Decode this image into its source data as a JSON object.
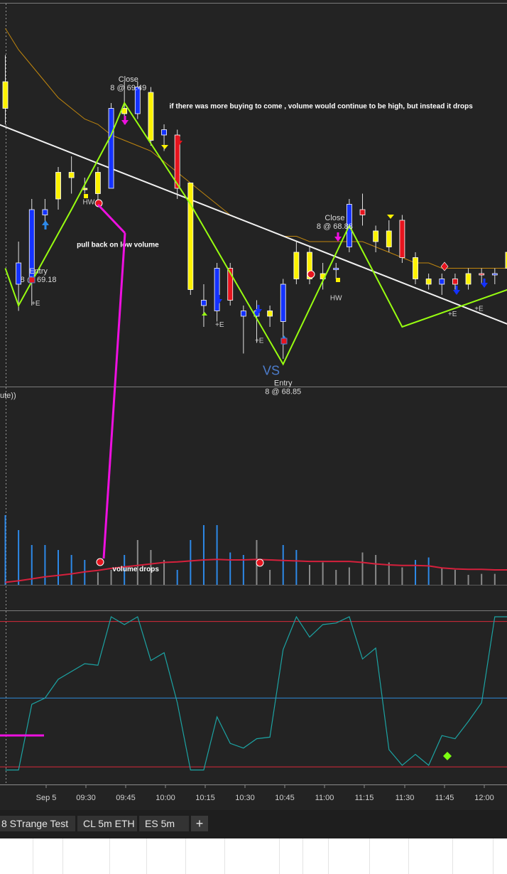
{
  "chart_data": [
    {
      "type": "candlestick",
      "x_labels": [
        "Sep 5",
        "09:30",
        "09:45",
        "10:00",
        "10:15",
        "10:30",
        "10:45",
        "11:00",
        "11:15",
        "11:30",
        "11:45",
        "12:00"
      ],
      "candles": [
        {
          "o": 69.42,
          "h": 69.47,
          "l": 69.34,
          "c": 69.37,
          "color": "yellow"
        },
        {
          "o": 69.04,
          "h": 69.12,
          "l": 68.99,
          "c": 69.08,
          "color": "blue"
        },
        {
          "o": 69.05,
          "h": 69.2,
          "l": 69.0,
          "c": 69.18,
          "color": "blue"
        },
        {
          "o": 69.17,
          "h": 69.2,
          "l": 69.15,
          "c": 69.18,
          "color": "blue"
        },
        {
          "o": 69.2,
          "h": 69.26,
          "l": 69.18,
          "c": 69.25,
          "color": "yellow"
        },
        {
          "o": 69.25,
          "h": 69.28,
          "l": 69.21,
          "c": 69.24,
          "color": "yellow"
        },
        {
          "o": 69.22,
          "h": 69.24,
          "l": 69.21,
          "c": 69.22,
          "color": "yellow"
        },
        {
          "o": 69.21,
          "h": 69.26,
          "l": 69.19,
          "c": 69.25,
          "color": "yellow"
        },
        {
          "o": 69.22,
          "h": 69.38,
          "l": 69.22,
          "c": 69.37,
          "color": "blue"
        },
        {
          "o": 69.36,
          "h": 69.42,
          "l": 69.34,
          "c": 69.37,
          "color": "yellow"
        },
        {
          "o": 69.36,
          "h": 69.42,
          "l": 69.35,
          "c": 69.41,
          "color": "blue"
        },
        {
          "o": 69.4,
          "h": 69.41,
          "l": 69.3,
          "c": 69.31,
          "color": "yellow"
        },
        {
          "o": 69.32,
          "h": 69.34,
          "l": 69.29,
          "c": 69.33,
          "color": "blue"
        },
        {
          "o": 69.32,
          "h": 69.33,
          "l": 69.2,
          "c": 69.22,
          "color": "red"
        },
        {
          "o": 69.23,
          "h": 69.23,
          "l": 69.02,
          "c": 69.03,
          "color": "yellow"
        },
        {
          "o": 69.01,
          "h": 69.04,
          "l": 68.96,
          "c": 69.0,
          "color": "blue"
        },
        {
          "o": 68.99,
          "h": 69.08,
          "l": 68.97,
          "c": 69.07,
          "color": "blue"
        },
        {
          "o": 69.07,
          "h": 69.08,
          "l": 69.0,
          "c": 69.01,
          "color": "red"
        },
        {
          "o": 68.98,
          "h": 69.0,
          "l": 68.91,
          "c": 68.99,
          "color": "blue"
        },
        {
          "o": 68.99,
          "h": 69.01,
          "l": 68.93,
          "c": 68.98,
          "color": "blue"
        },
        {
          "o": 68.99,
          "h": 69.0,
          "l": 68.96,
          "c": 68.98,
          "color": "yellow"
        },
        {
          "o": 68.97,
          "h": 69.05,
          "l": 68.9,
          "c": 69.04,
          "color": "blue"
        },
        {
          "o": 69.1,
          "h": 69.12,
          "l": 69.04,
          "c": 69.05,
          "color": "yellow"
        },
        {
          "o": 69.1,
          "h": 69.11,
          "l": 69.04,
          "c": 69.05,
          "color": "yellow"
        },
        {
          "o": 69.06,
          "h": 69.08,
          "l": 69.03,
          "c": 69.05,
          "color": "yellow"
        },
        {
          "o": 69.07,
          "h": 69.08,
          "l": 69.05,
          "c": 69.07,
          "color": "blue"
        },
        {
          "o": 69.11,
          "h": 69.2,
          "l": 69.1,
          "c": 69.19,
          "color": "blue"
        },
        {
          "o": 69.18,
          "h": 69.21,
          "l": 69.15,
          "c": 69.17,
          "color": "red"
        },
        {
          "o": 69.14,
          "h": 69.15,
          "l": 69.1,
          "c": 69.12,
          "color": "yellow"
        },
        {
          "o": 69.14,
          "h": 69.16,
          "l": 69.1,
          "c": 69.11,
          "color": "yellow"
        },
        {
          "o": 69.16,
          "h": 69.17,
          "l": 69.08,
          "c": 69.09,
          "color": "red"
        },
        {
          "o": 69.09,
          "h": 69.1,
          "l": 69.04,
          "c": 69.05,
          "color": "yellow"
        },
        {
          "o": 69.05,
          "h": 69.06,
          "l": 69.03,
          "c": 69.04,
          "color": "yellow"
        },
        {
          "o": 69.05,
          "h": 69.06,
          "l": 69.02,
          "c": 69.04,
          "color": "blue"
        },
        {
          "o": 69.05,
          "h": 69.06,
          "l": 69.03,
          "c": 69.04,
          "color": "red"
        },
        {
          "o": 69.06,
          "h": 69.07,
          "l": 69.03,
          "c": 69.04,
          "color": "yellow"
        },
        {
          "o": 69.06,
          "h": 69.07,
          "l": 69.04,
          "c": 69.06,
          "color": "red"
        },
        {
          "o": 69.06,
          "h": 69.07,
          "l": 69.04,
          "c": 69.06,
          "color": "blue"
        },
        {
          "o": 69.07,
          "h": 69.11,
          "l": 69.06,
          "c": 69.1,
          "color": "yellow"
        }
      ],
      "moving_average": [
        69.52,
        69.48,
        69.45,
        69.42,
        69.39,
        69.37,
        69.35,
        69.34,
        69.32,
        69.31,
        69.3,
        69.29,
        69.27,
        69.25,
        69.23,
        69.21,
        69.19,
        69.17,
        69.16,
        69.15,
        69.14,
        69.13,
        69.13,
        69.12,
        69.12,
        69.12,
        69.12,
        69.12,
        69.11,
        69.1,
        69.09,
        69.08,
        69.08,
        69.07,
        69.07,
        69.07,
        69.07,
        69.07,
        69.07
      ],
      "zigzag": [
        [
          0,
          69.07
        ],
        [
          1,
          69.0
        ],
        [
          5,
          69.18
        ],
        [
          8,
          69.32
        ],
        [
          9,
          69.38
        ],
        [
          14,
          69.19
        ],
        [
          21,
          68.89
        ],
        [
          26,
          69.15
        ],
        [
          30,
          68.96
        ],
        [
          38,
          69.03
        ]
      ],
      "trendline": [
        [
          -0.5,
          69.34
        ],
        [
          38.5,
          68.96
        ]
      ],
      "annotations": [
        {
          "kind": "close",
          "label": "Close",
          "detail": "8 @ 69.49",
          "x": 9.3,
          "y": 69.42
        },
        {
          "kind": "entry",
          "label": "Entry",
          "detail": "8 @ 69.18",
          "x": 2.5,
          "y": 69.06
        },
        {
          "kind": "close",
          "label": "Close",
          "detail": "8 @ 68.88",
          "x": 24.9,
          "y": 69.16
        },
        {
          "kind": "entry",
          "label": "Entry",
          "detail": "8 @ 68.85",
          "x": 21.0,
          "y": 68.85
        },
        {
          "kind": "hw",
          "label": "HW",
          "x": 6.3,
          "y": 69.19
        },
        {
          "kind": "hw",
          "label": "HW",
          "x": 25.0,
          "y": 69.01
        },
        {
          "kind": "e",
          "label": "+E",
          "x": 2.3,
          "y": 69.0
        },
        {
          "kind": "e",
          "label": "+E",
          "x": 16.2,
          "y": 68.96
        },
        {
          "kind": "e",
          "label": "+E",
          "x": 19.2,
          "y": 68.93
        },
        {
          "kind": "e",
          "label": "+E",
          "x": 33.8,
          "y": 68.98
        },
        {
          "kind": "e",
          "label": "+E",
          "x": 35.8,
          "y": 68.99
        },
        {
          "kind": "note",
          "label": "if there  was more buying to come , volume would continue to be high, but instead it drops",
          "x": 12.4,
          "y": 69.37
        },
        {
          "kind": "note",
          "label": "pull back on low volume",
          "x": 5.4,
          "y": 69.11
        },
        {
          "kind": "vs",
          "label": "VS",
          "x": 20.1,
          "y": 68.87
        }
      ]
    },
    {
      "type": "bar",
      "title": "ute))",
      "volume": [
        14,
        11,
        8,
        8,
        7,
        6,
        5,
        2.5,
        3,
        6,
        9,
        7,
        5,
        3,
        9,
        12,
        12,
        6.5,
        6,
        9,
        3,
        8,
        7,
        4,
        4.5,
        3,
        3.5,
        6.5,
        6,
        4.5,
        3.5,
        5,
        5.5,
        3.5,
        3,
        2,
        2.2,
        2.2,
        2.2
      ],
      "bar_colors": [
        "blue",
        "blue",
        "blue",
        "blue",
        "blue",
        "blue",
        "blue",
        "gray",
        "gray",
        "blue",
        "gray",
        "gray",
        "gray",
        "blue",
        "blue",
        "blue",
        "blue",
        "blue",
        "blue",
        "gray",
        "gray",
        "blue",
        "blue",
        "gray",
        "gray",
        "gray",
        "gray",
        "gray",
        "gray",
        "gray",
        "gray",
        "blue",
        "blue",
        "gray",
        "gray",
        "gray",
        "gray",
        "gray",
        "gray"
      ],
      "average": [
        0.5,
        0.8,
        1.2,
        1.6,
        1.9,
        2.2,
        2.6,
        2.9,
        3.3,
        3.6,
        3.9,
        4.2,
        4.5,
        4.6,
        4.8,
        5.0,
        5.1,
        5.0,
        5.0,
        5.1,
        5.0,
        4.9,
        4.8,
        4.7,
        4.7,
        4.7,
        4.7,
        4.5,
        4.2,
        4.0,
        3.9,
        3.9,
        3.8,
        3.4,
        3.2,
        3.1,
        3.1,
        3.0,
        3.0
      ],
      "annotations": [
        {
          "kind": "note",
          "label": "volume drops",
          "x": 8.1,
          "y": 2.7
        }
      ]
    },
    {
      "type": "line",
      "oscillator": [
        2,
        2,
        44,
        48,
        60,
        65,
        70,
        69,
        100,
        95,
        100,
        72,
        77,
        45,
        2,
        2,
        36,
        19,
        16,
        22,
        23,
        79,
        100,
        87,
        95,
        96,
        100,
        73,
        80,
        15,
        5,
        12,
        5,
        24,
        22,
        33,
        45,
        100,
        100
      ],
      "levels": [
        97,
        48,
        4
      ],
      "ylim": [
        0,
        102
      ]
    }
  ],
  "tabs": [
    {
      "label": "8 STrange Test"
    },
    {
      "label": "CL 5m ETH"
    },
    {
      "label": "ES 5m"
    }
  ],
  "add_tab_label": "+",
  "colors": {
    "background": "#232323",
    "bull_candle": "#fdf200",
    "bear_candle": "#e6141e",
    "blue_candle": "#1432ff",
    "zigzag": "#98ff10",
    "trendline": "#f2f2f2",
    "moving_average": "#c0860e",
    "annotation": "#ee10e0",
    "volume_up": "#2d89e8",
    "volume_down": "#8a8a8a",
    "volume_average": "#d6203c",
    "oscillator": "#1ca3a3",
    "level_line": "#d82a3a",
    "mid_level": "#2e8cd8"
  }
}
